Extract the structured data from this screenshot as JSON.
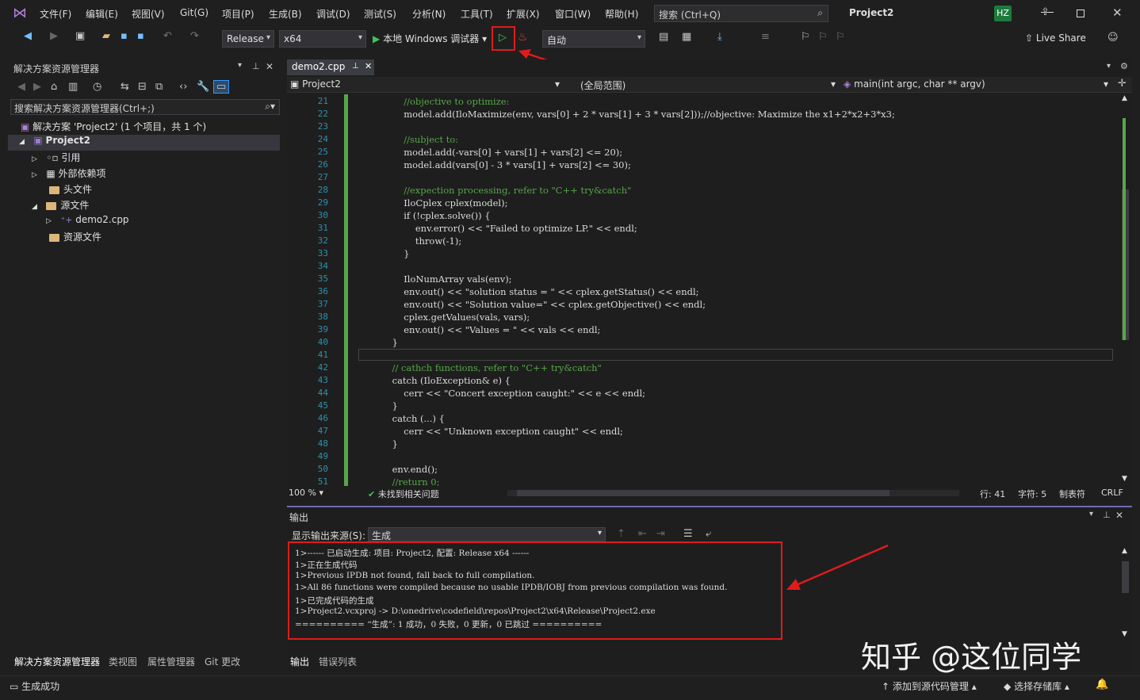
{
  "titlebar": {
    "menus": [
      "文件(F)",
      "编辑(E)",
      "视图(V)",
      "Git(G)",
      "项目(P)",
      "生成(B)",
      "调试(D)",
      "测试(S)",
      "分析(N)",
      "工具(T)",
      "扩展(X)",
      "窗口(W)",
      "帮助(H)"
    ],
    "search_placeholder": "搜索 (Ctrl+Q)",
    "project_name": "Project2",
    "avatar_initials": "HZ"
  },
  "toolbar": {
    "config": "Release",
    "platform": "x64",
    "debugger": "本地 Windows 调试器",
    "auto": "自动",
    "live_share": "Live Share"
  },
  "solution_explorer": {
    "title": "解决方案资源管理器",
    "search_placeholder": "搜索解决方案资源管理器(Ctrl+;)",
    "solution": "解决方案 'Project2' (1 个项目，共 1 个)",
    "project": "Project2",
    "items": [
      "引用",
      "外部依赖项",
      "头文件",
      "源文件",
      "demo2.cpp",
      "资源文件"
    ],
    "bottom_tabs": [
      "解决方案资源管理器",
      "类视图",
      "属性管理器",
      "Git 更改"
    ]
  },
  "editor": {
    "tab": "demo2.cpp",
    "nav_project": "Project2",
    "nav_scope": "(全局范围)",
    "nav_function": "main(int argc, char ** argv)",
    "lines": [
      {
        "n": "21",
        "t": "        //objective to optimize:"
      },
      {
        "n": "22",
        "t": "        model.add(IloMaximize(env, vars[0] + 2 * vars[1] + 3 * vars[2]));//objective: Maximize the x1+2*x2+3*x3;"
      },
      {
        "n": "23",
        "t": ""
      },
      {
        "n": "24",
        "t": "        //subject to:"
      },
      {
        "n": "25",
        "t": "        model.add(-vars[0] + vars[1] + vars[2] <= 20);"
      },
      {
        "n": "26",
        "t": "        model.add(vars[0] - 3 * vars[1] + vars[2] <= 30);"
      },
      {
        "n": "27",
        "t": ""
      },
      {
        "n": "28",
        "t": "        //expection processing, refer to \"C++ try&catch\""
      },
      {
        "n": "29",
        "t": "        IloCplex cplex(model);"
      },
      {
        "n": "30",
        "t": "        if (!cplex.solve()) {"
      },
      {
        "n": "31",
        "t": "            env.error() << \"Failed to optimize LP.\" << endl;"
      },
      {
        "n": "32",
        "t": "            throw(-1);"
      },
      {
        "n": "33",
        "t": "        }"
      },
      {
        "n": "34",
        "t": ""
      },
      {
        "n": "35",
        "t": "        IloNumArray vals(env);"
      },
      {
        "n": "36",
        "t": "        env.out() << \"solution status = \" << cplex.getStatus() << endl;"
      },
      {
        "n": "37",
        "t": "        env.out() << \"Solution value=\" << cplex.getObjective() << endl;"
      },
      {
        "n": "38",
        "t": "        cplex.getValues(vals, vars);"
      },
      {
        "n": "39",
        "t": "        env.out() << \"Values = \" << vals << endl;"
      },
      {
        "n": "40",
        "t": "    }"
      },
      {
        "n": "41",
        "t": ""
      },
      {
        "n": "42",
        "t": "    // cathch functions, refer to \"C++ try&catch\""
      },
      {
        "n": "43",
        "t": "    catch (IloException& e) {"
      },
      {
        "n": "44",
        "t": "        cerr << \"Concert exception caught:\" << e << endl;"
      },
      {
        "n": "45",
        "t": "    }"
      },
      {
        "n": "46",
        "t": "    catch (...) {"
      },
      {
        "n": "47",
        "t": "        cerr << \"Unknown exception caught\" << endl;"
      },
      {
        "n": "48",
        "t": "    }"
      },
      {
        "n": "49",
        "t": ""
      },
      {
        "n": "50",
        "t": "    env.end();"
      },
      {
        "n": "51",
        "t": "    //return 0;"
      }
    ],
    "zoom": "100 %",
    "issues": "未找到相关问题",
    "line": "行: 41",
    "col": "字符: 5",
    "tabs_mode": "制表符",
    "eol": "CRLF"
  },
  "output": {
    "title": "输出",
    "source_label": "显示输出来源(S):",
    "source_value": "生成",
    "lines": [
      "1>------ 已启动生成: 项目: Project2, 配置: Release x64 ------",
      "1>正在生成代码",
      "1>Previous IPDB not found, fall back to full compilation.",
      "1>All 86 functions were compiled because no usable IPDB/IOBJ from previous compilation was found.",
      "1>已完成代码的生成",
      "1>Project2.vcxproj -> D:\\onedrive\\codefield\\repos\\Project2\\x64\\Release\\Project2.exe",
      "========== “生成”: 1 成功，0 失败，0 更新，0 已跳过 =========="
    ],
    "bottom_tabs": [
      "输出",
      "错误列表"
    ]
  },
  "watermark": "知乎 @这位同学",
  "statusbar": {
    "status": "生成成功",
    "add_source": "添加到源代码管理",
    "select_repo": "选择存储库"
  }
}
